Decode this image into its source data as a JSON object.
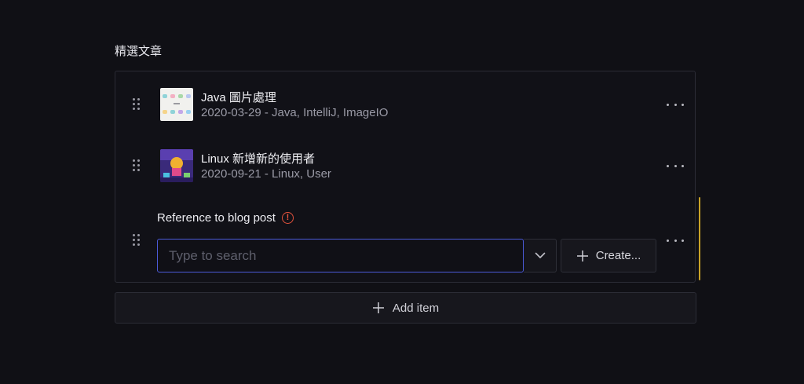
{
  "field": {
    "label": "精選文章"
  },
  "items": [
    {
      "title": "Java 圖片處理",
      "subtitle": "2020-03-29 - Java, IntelliJ, ImageIO",
      "thumbnail": "java-image-thumbnail"
    },
    {
      "title": "Linux 新增新的使用者",
      "subtitle": "2020-09-21 - Linux, User",
      "thumbnail": "linux-user-thumbnail"
    }
  ],
  "reference": {
    "label": "Reference to blog post",
    "status_icon": "warning-icon",
    "search_placeholder": "Type to search",
    "search_value": "",
    "create_label": "Create..."
  },
  "actions": {
    "add_item_label": "Add item"
  },
  "colors": {
    "background": "#101015",
    "focus_border": "#4b5bd9",
    "warning": "#e5533d",
    "scroll_indicator": "#c9a227"
  }
}
